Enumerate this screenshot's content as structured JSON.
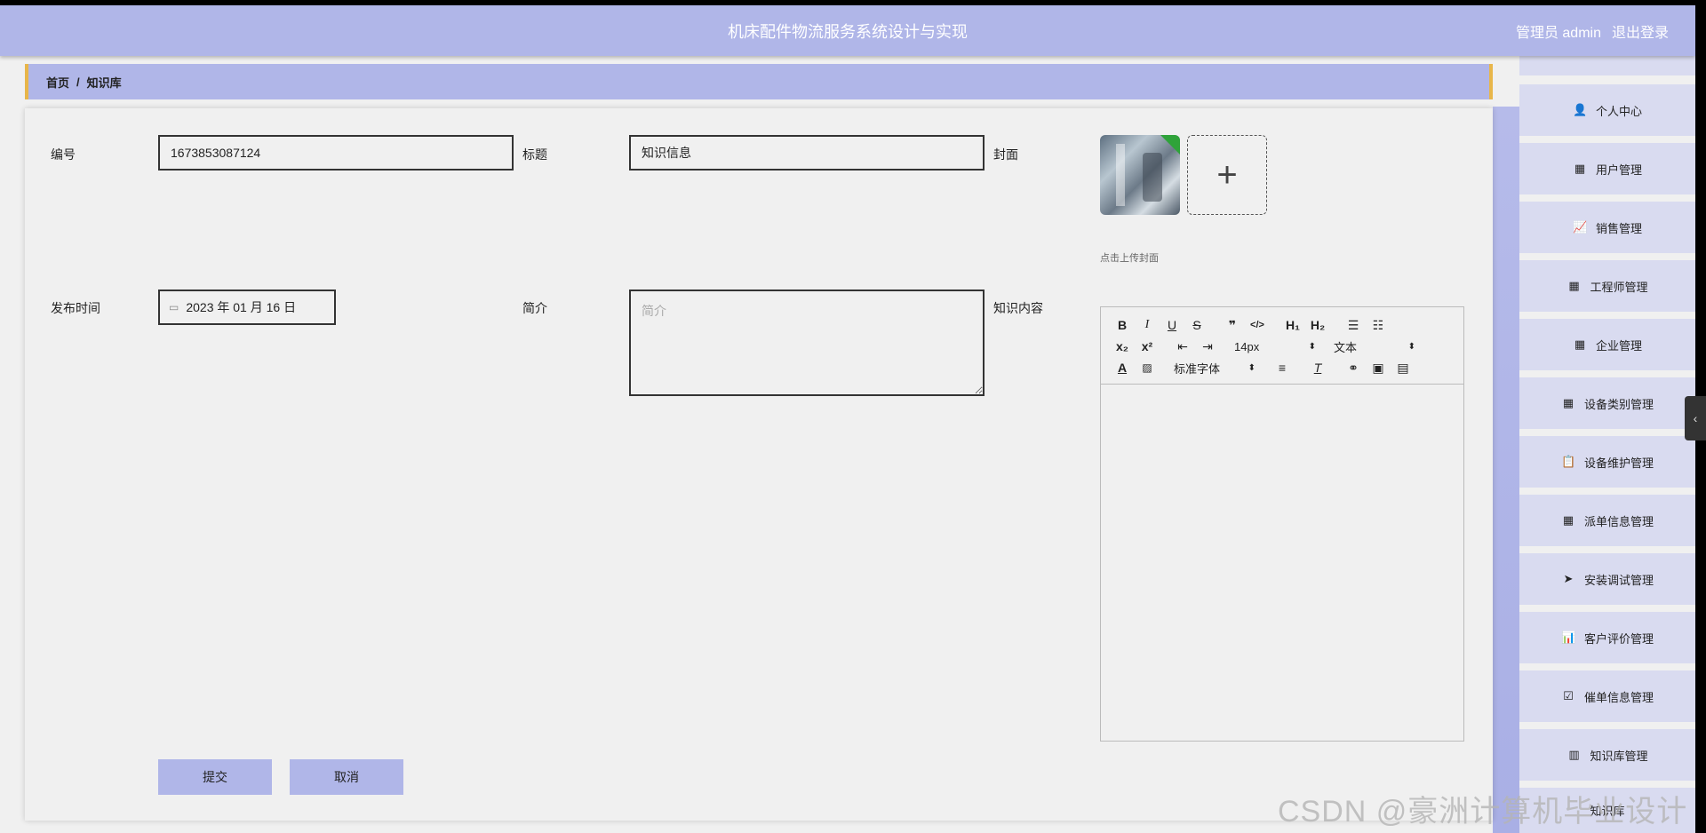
{
  "header": {
    "title": "机床配件物流服务系统设计与实现",
    "user_label": "管理员 admin",
    "logout_label": "退出登录"
  },
  "breadcrumb": {
    "home": "首页",
    "separator": "/",
    "current": "知识库"
  },
  "form": {
    "id_label": "编号",
    "id_value": "1673853087124",
    "title_label": "标题",
    "title_value": "知识信息",
    "cover_label": "封面",
    "cover_hint": "点击上传封面",
    "publish_label": "发布时间",
    "publish_value": "2023 年 01 月 16 日",
    "intro_label": "简介",
    "intro_placeholder": "简介",
    "content_label": "知识内容",
    "submit_label": "提交",
    "cancel_label": "取消"
  },
  "editor": {
    "font_size": "14px",
    "block_type": "文本",
    "font_family": "标准字体"
  },
  "sidebar": {
    "items": [
      {
        "label": "个人中心",
        "icon": "user-icon"
      },
      {
        "label": "用户管理",
        "icon": "grid-icon"
      },
      {
        "label": "销售管理",
        "icon": "chart-icon"
      },
      {
        "label": "工程师管理",
        "icon": "grid-icon"
      },
      {
        "label": "企业管理",
        "icon": "grid-icon"
      },
      {
        "label": "设备类别管理",
        "icon": "grid-icon"
      },
      {
        "label": "设备维护管理",
        "icon": "clipboard-icon"
      },
      {
        "label": "派单信息管理",
        "icon": "grid-icon"
      },
      {
        "label": "安装调试管理",
        "icon": "send-icon"
      },
      {
        "label": "客户评价管理",
        "icon": "bar-chart-icon"
      },
      {
        "label": "催单信息管理",
        "icon": "clipboard-check-icon"
      },
      {
        "label": "知识库管理",
        "icon": "library-icon"
      }
    ],
    "partial_item": "知识库"
  },
  "watermark": "CSDN @豪洲计算机毕业设计",
  "colors": {
    "accent": "#b0b6e8",
    "breadcrumb_border": "#e8b64a",
    "menu_bg": "#d9dbf0"
  }
}
